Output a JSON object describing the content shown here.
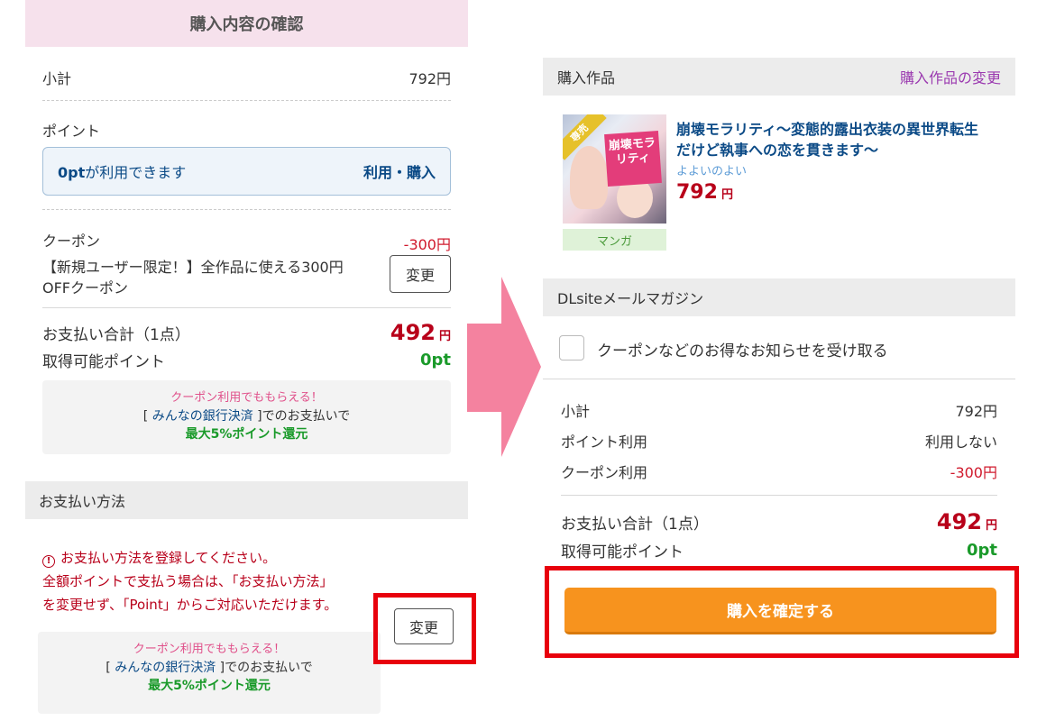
{
  "left": {
    "header_title": "購入内容の確認",
    "subtotal": {
      "label": "小計",
      "value": "792円"
    },
    "point": {
      "title": "ポイント",
      "available_amount": "0pt",
      "available_text": "が利用できます",
      "use_label": "利用・購入"
    },
    "coupon": {
      "title": "クーポン",
      "amount": "-300円",
      "description": "【新規ユーザー限定！】全作品に使える300円OFFクーポン",
      "change_label": "変更"
    },
    "total": {
      "label": "お支払い合計（1点）",
      "amount": "492",
      "yen": "円"
    },
    "earn": {
      "label": "取得可能ポイント",
      "value": "0pt"
    },
    "promo": {
      "line1": "クーポン利用でももらえる！",
      "bracket_open": "[ ",
      "bank_link": "みんなの銀行決済",
      "bracket_close": " ]でのお支払いで",
      "line3": "最大5%ポイント還元"
    },
    "payment": {
      "header": "お支払い方法",
      "alert_line1": "お支払い方法を登録してください。",
      "alert_line2": "全額ポイントで支払う場合は、「お支払い方法」",
      "alert_line3": "を変更せず、「Point」からご対応いただけます。",
      "change_label": "変更"
    }
  },
  "right": {
    "purchase_header": "購入作品",
    "purchase_change_link": "購入作品の変更",
    "product": {
      "sale_tag": "専売",
      "cover_title": "崩壊モラリティ",
      "title": "崩壊モラリティ〜変態的露出衣装の異世界転生だけど執事への恋を貫きます〜",
      "circle": "よよいのよい",
      "price": "792",
      "yen": "円",
      "genre": "マンガ"
    },
    "mail_header": "DLsiteメールマガジン",
    "mail_checkbox_label": "クーポンなどのお得なお知らせを受け取る",
    "summary": {
      "subtotal_label": "小計",
      "subtotal_value": "792円",
      "point_label": "ポイント利用",
      "point_value": "利用しない",
      "coupon_label": "クーポン利用",
      "coupon_value": "-300円",
      "total_label": "お支払い合計（1点）",
      "total_amount": "492",
      "total_yen": "円",
      "earn_label": "取得可能ポイント",
      "earn_value": "0pt"
    },
    "confirm_button": "購入を確定する"
  },
  "colors": {
    "header_pink": "#f6e1ec",
    "price_red": "#b8001a",
    "coupon_red": "#d0192c",
    "point_green": "#1a9a2a",
    "link_blue": "#0b4a86",
    "link_purple": "#9b3ab0",
    "confirm_orange": "#f7931e",
    "highlight_red": "#e8000c",
    "arrow_pink": "#f4829f"
  },
  "icons": {
    "alert": "exclamation-circle-icon",
    "arrow": "right-arrow-icon"
  }
}
